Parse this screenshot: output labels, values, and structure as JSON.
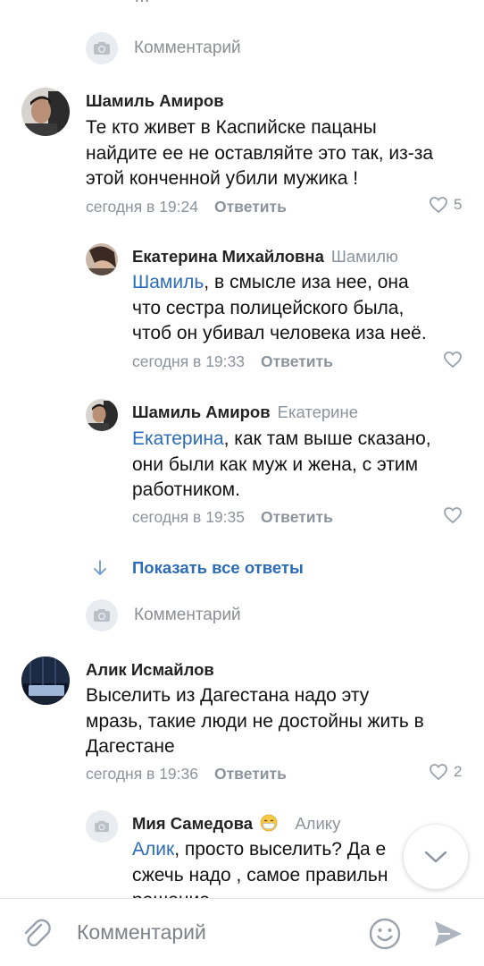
{
  "top_clipped_text": "…",
  "comment_prompt_1": "Комментарий",
  "comment_prompt_2": "Комментарий",
  "comments": [
    {
      "author": "Шамиль Амиров",
      "lines": [
        "Те кто живет в Каспийске пацаны",
        "найдите ее не оставляйте это так, из-за",
        "этой конченной убили мужика !"
      ],
      "time": "сегодня в 19:24",
      "reply": "Ответить",
      "likes": "5"
    },
    {
      "author": "Екатерина Михайловна",
      "reply_to": "Шамилю",
      "mention": "Шамиль",
      "line1_rest": ", в смысле иза нее, она",
      "lines": [
        "что сестра полицейского была,",
        "чтоб он убивал человека иза неё."
      ],
      "time": "сегодня в 19:33",
      "reply": "Ответить"
    },
    {
      "author": "Шамиль Амиров",
      "reply_to": "Екатерине",
      "mention": "Екатерина",
      "line1_rest": ", как там выше сказано,",
      "lines": [
        "они были как муж и жена, с этим",
        "работником."
      ],
      "time": "сегодня в 19:35",
      "reply": "Ответить"
    },
    {
      "author": "Алик Исмайлов",
      "lines": [
        "Выселить из Дагестана надо эту",
        "мразь, такие люди не достойны жить в",
        "Дагестане"
      ],
      "time": "сегодня в 19:36",
      "reply": "Ответить",
      "likes": "2"
    },
    {
      "author": "Мия Самедова",
      "author_emoji": "😷",
      "reply_to": "Алику",
      "mention": "Алик",
      "line1_rest": ", просто выселить? Да е",
      "lines": [
        "сжечь надо , самое правильн",
        "решение"
      ]
    }
  ],
  "show_all_replies": "Показать все ответы",
  "bottom_bar": {
    "placeholder": "Комментарий"
  },
  "icons": {
    "camera": "camera-icon",
    "heart": "heart-icon",
    "arrow_down": "arrow-down-icon",
    "chevron_down": "chevron-down-icon",
    "attach": "paperclip-icon",
    "emoji": "smile-icon",
    "send": "send-icon"
  },
  "colors": {
    "link": "#2c6bb7",
    "secondary_text": "#8b939c",
    "camera_bg": "#e9ecf0"
  }
}
